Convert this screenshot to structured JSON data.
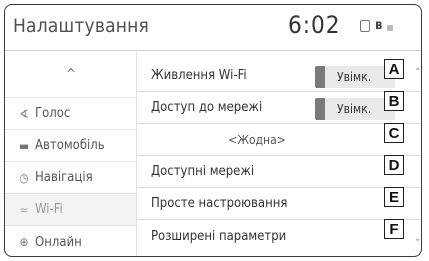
{
  "header": {
    "title": "Налаштування",
    "clock": "6:02"
  },
  "status_icons": [
    "phone-icon",
    "bluetooth-icon",
    "signal-icon"
  ],
  "sidebar": {
    "up_arrow": "^",
    "items": [
      {
        "icon": "voice-icon",
        "label": "Голос"
      },
      {
        "icon": "car-icon",
        "label": "Автомобіль"
      },
      {
        "icon": "navigation-icon",
        "label": "Навігація"
      },
      {
        "icon": "wifi-icon",
        "label": "Wi-Fi",
        "active": true
      },
      {
        "icon": "globe-icon",
        "label": "Онлайн"
      }
    ]
  },
  "content": {
    "rows": [
      {
        "label": "Живлення Wi-Fi",
        "toggle": "Увімк.",
        "callout": "A"
      },
      {
        "label": "Доступ до мережі",
        "toggle": "Увімк.",
        "callout": "B"
      },
      {
        "value": "<Жодна>",
        "callout": "C"
      },
      {
        "label": "Доступні мережі",
        "callout": "D"
      },
      {
        "label": "Просте настроювання",
        "callout": "E"
      },
      {
        "label": "Розширені параметри",
        "callout": "F"
      }
    ]
  }
}
